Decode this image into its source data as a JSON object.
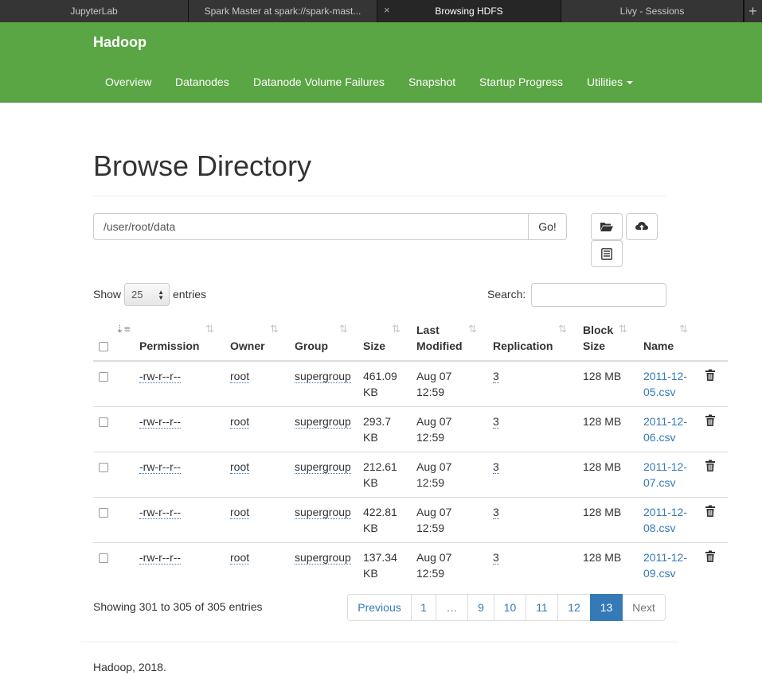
{
  "browser": {
    "tabs": [
      {
        "label": "JupyterLab"
      },
      {
        "label": "Spark Master at spark://spark-mast..."
      },
      {
        "label": "Browsing HDFS"
      },
      {
        "label": "Livy - Sessions"
      }
    ],
    "new_tab_glyph": "+",
    "close_glyph": "×"
  },
  "navbar": {
    "brand": "Hadoop",
    "items": [
      "Overview",
      "Datanodes",
      "Datanode Volume Failures",
      "Snapshot",
      "Startup Progress",
      "Utilities"
    ],
    "color": "#5aa544"
  },
  "page": {
    "title": "Browse Directory",
    "path_value": "/user/root/data",
    "go_label": "Go!",
    "icons": [
      "folder-open-icon",
      "cloud-upload-icon",
      "list-alt-icon"
    ]
  },
  "controls": {
    "show_label": "Show",
    "entries_value": "25",
    "entries_label": "entries",
    "search_label": "Search:",
    "search_value": ""
  },
  "table": {
    "headers": {
      "permission": "Permission",
      "owner": "Owner",
      "group": "Group",
      "size": "Size",
      "last_modified_1": "Last",
      "last_modified_2": "Modified",
      "replication": "Replication",
      "block_size_1": "Block",
      "block_size_2": "Size",
      "name": "Name"
    },
    "rows": [
      {
        "permission": "-rw-r--r--",
        "owner": "root",
        "group": "supergroup",
        "size1": "461.09",
        "size2": "KB",
        "mod1": "Aug 07",
        "mod2": "12:59",
        "replication": "3",
        "block_size": "128 MB",
        "name1": "2011-12-",
        "name2": "05.csv"
      },
      {
        "permission": "-rw-r--r--",
        "owner": "root",
        "group": "supergroup",
        "size1": "293.7",
        "size2": "KB",
        "mod1": "Aug 07",
        "mod2": "12:59",
        "replication": "3",
        "block_size": "128 MB",
        "name1": "2011-12-",
        "name2": "06.csv"
      },
      {
        "permission": "-rw-r--r--",
        "owner": "root",
        "group": "supergroup",
        "size1": "212.61",
        "size2": "KB",
        "mod1": "Aug 07",
        "mod2": "12:59",
        "replication": "3",
        "block_size": "128 MB",
        "name1": "2011-12-",
        "name2": "07.csv"
      },
      {
        "permission": "-rw-r--r--",
        "owner": "root",
        "group": "supergroup",
        "size1": "422.81",
        "size2": "KB",
        "mod1": "Aug 07",
        "mod2": "12:59",
        "replication": "3",
        "block_size": "128 MB",
        "name1": "2011-12-",
        "name2": "08.csv"
      },
      {
        "permission": "-rw-r--r--",
        "owner": "root",
        "group": "supergroup",
        "size1": "137.34",
        "size2": "KB",
        "mod1": "Aug 07",
        "mod2": "12:59",
        "replication": "3",
        "block_size": "128 MB",
        "name1": "2011-12-",
        "name2": "09.csv"
      }
    ]
  },
  "pagination": {
    "info": "Showing 301 to 305 of 305 entries",
    "previous": "Previous",
    "pages": [
      "1",
      "…",
      "9",
      "10",
      "11",
      "12",
      "13"
    ],
    "active_page": "13",
    "next": "Next",
    "accent_color": "#337ab7"
  },
  "footer": {
    "text": "Hadoop, 2018."
  }
}
